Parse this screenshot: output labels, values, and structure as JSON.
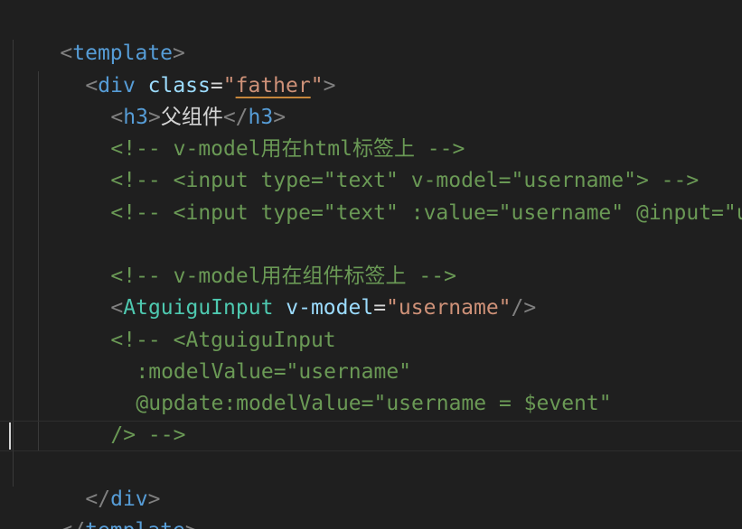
{
  "editor": {
    "language": "vue",
    "colors": {
      "background": "#1f1f1f",
      "tag": "#569cd6",
      "attribute": "#9cdcfe",
      "string": "#ce9178",
      "comment": "#6a9955",
      "component": "#4ec9b0",
      "bracket": "#808080"
    },
    "lines": [
      {
        "parts": [
          "<",
          "template",
          ">"
        ]
      },
      {
        "parts": [
          "<",
          "div",
          " class",
          "=",
          "\"",
          "father",
          "\"",
          ">"
        ]
      },
      {
        "parts": [
          "<",
          "h3",
          ">",
          "父组件",
          "</",
          "h3",
          ">"
        ]
      },
      {
        "parts": [
          "<!-- v-model用在html标签上 -->"
        ]
      },
      {
        "parts": [
          "<!-- <input type=\"text\" v-model=\"username\"> -->"
        ]
      },
      {
        "parts": [
          "<!-- <input type=\"text\" :value=\"username\" @input=\"use"
        ]
      },
      {
        "parts": [
          ""
        ]
      },
      {
        "parts": [
          "<!-- v-model用在组件标签上 -->"
        ]
      },
      {
        "parts": [
          "<",
          "AtguiguInput",
          " v-model",
          "=",
          "\"username\"",
          "/>"
        ]
      },
      {
        "parts": [
          "<!-- <AtguiguInput"
        ]
      },
      {
        "parts": [
          ":modelValue=\"username\""
        ]
      },
      {
        "parts": [
          "@update:modelValue=\"username = $event\""
        ]
      },
      {
        "parts": [
          "/> -->"
        ]
      },
      {
        "parts": [
          ""
        ]
      },
      {
        "parts": [
          "</",
          "div",
          ">"
        ]
      },
      {
        "parts": [
          "</",
          "template",
          ">"
        ]
      }
    ]
  }
}
